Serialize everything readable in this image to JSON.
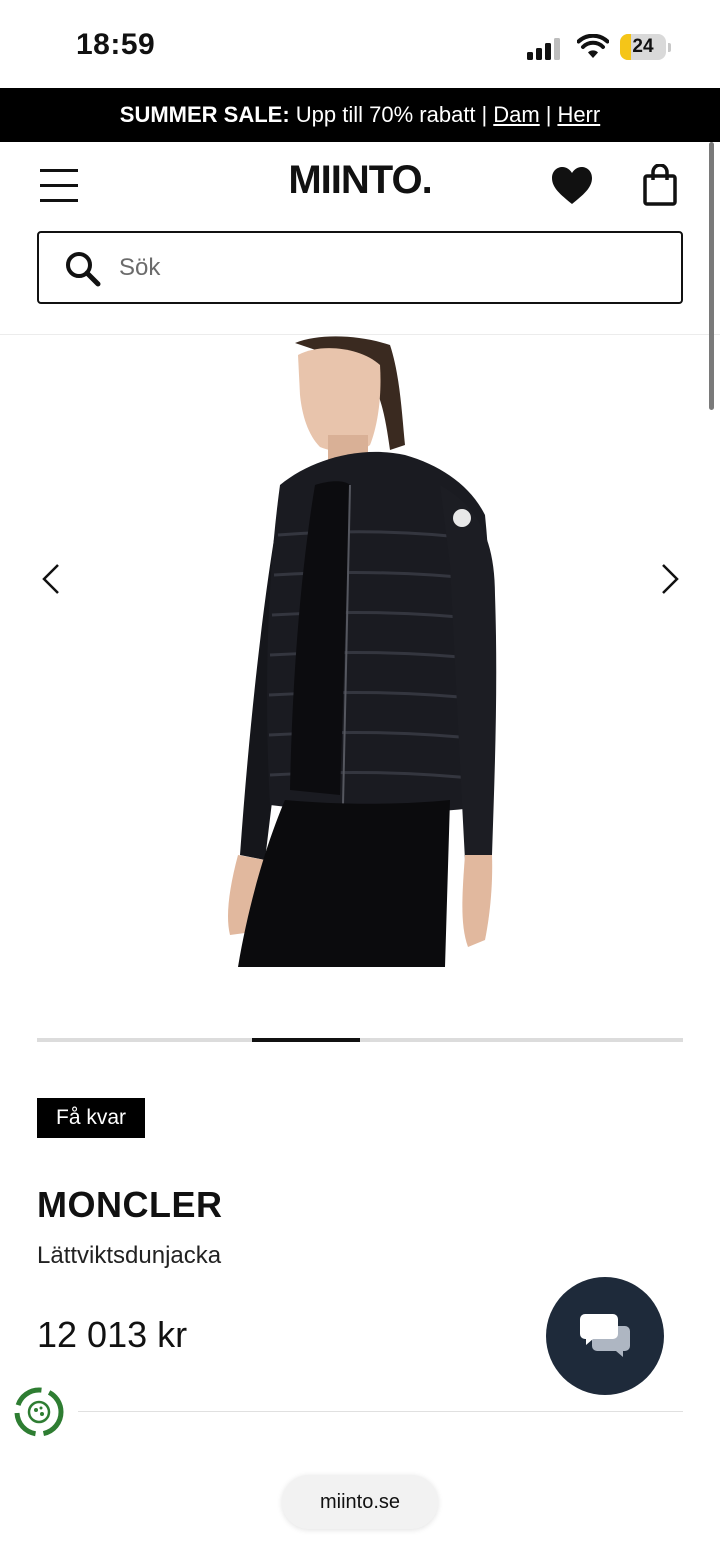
{
  "status_bar": {
    "time": "18:59",
    "battery_level": "24",
    "battery_fraction": 0.24
  },
  "promo": {
    "bold": "SUMMER SALE:",
    "text": "Upp till 70% rabatt",
    "sep1": "|",
    "link_women": "Dam",
    "sep2": "|",
    "link_men": "Herr"
  },
  "header": {
    "logo": "MIINTO.",
    "icons": [
      "menu-icon",
      "heart-icon",
      "shopping-bag-icon"
    ]
  },
  "search": {
    "placeholder": "Sök",
    "value": ""
  },
  "gallery": {
    "current_image": 3,
    "image_count": 6,
    "image_alt": "Moncler lättviktsdunjacka"
  },
  "product": {
    "badge": "Få kvar",
    "brand": "MONCLER",
    "name": "Lättviktsdunjacka",
    "price": "12 013 kr"
  },
  "browser": {
    "url": "miinto.se"
  },
  "colors": {
    "chat_bg": "#1e2a3a",
    "eco_green": "#2e7d32",
    "battery_yellow": "#f5c518",
    "promo_bg": "#000000"
  }
}
